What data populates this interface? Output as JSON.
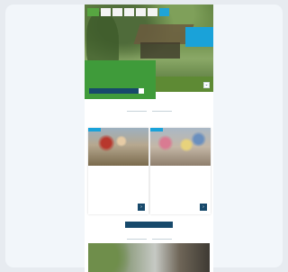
{
  "nav": {
    "items": [
      "",
      "",
      "",
      "",
      "",
      ""
    ]
  },
  "hero": {
    "badge": "",
    "kicker": "",
    "headline": "",
    "cta_label": ""
  },
  "news_section": {
    "title": "",
    "cards": [
      {
        "date": "",
        "title": "",
        "tag": "",
        "text": ""
      },
      {
        "date": "",
        "title": "",
        "tag": "",
        "text": ""
      }
    ],
    "all_news_label": ""
  },
  "second_section": {
    "title": ""
  },
  "colors": {
    "brand_green": "#3f9b3a",
    "accent_blue": "#1aa2d9",
    "navy": "#17496b"
  }
}
